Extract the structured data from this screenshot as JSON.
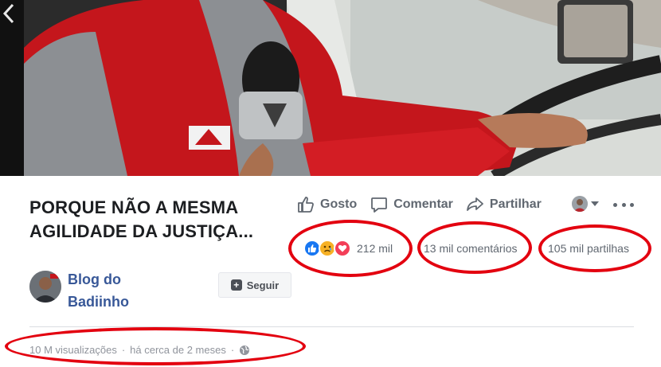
{
  "video": {
    "prev_icon": "chevron-left-icon"
  },
  "post": {
    "title_line1": "PORQUE NÃO A MESMA",
    "title_line2": "AGILIDADE DA JUSTIÇA..."
  },
  "actions": {
    "like_label": "Gosto",
    "comment_label": "Comentar",
    "share_label": "Partilhar"
  },
  "stats": {
    "reactions_count": "212 mil",
    "reactions": [
      "like-icon",
      "sad-icon",
      "love-icon"
    ],
    "comments": "13 mil comentários",
    "shares": "105 mil partilhas"
  },
  "page": {
    "author_line1": "Blog do",
    "author_line2": "Badiinho",
    "follow_label": "Seguir"
  },
  "meta": {
    "views": "10 M visualizações",
    "separator": "·",
    "time": "há cerca de 2 meses",
    "privacy_icon": "globe-icon"
  },
  "colors": {
    "link": "#385898",
    "annotation": "#e3000f",
    "like_blue": "#1877f2",
    "love_red": "#f33e58",
    "sad_yellow": "#f7b125"
  }
}
